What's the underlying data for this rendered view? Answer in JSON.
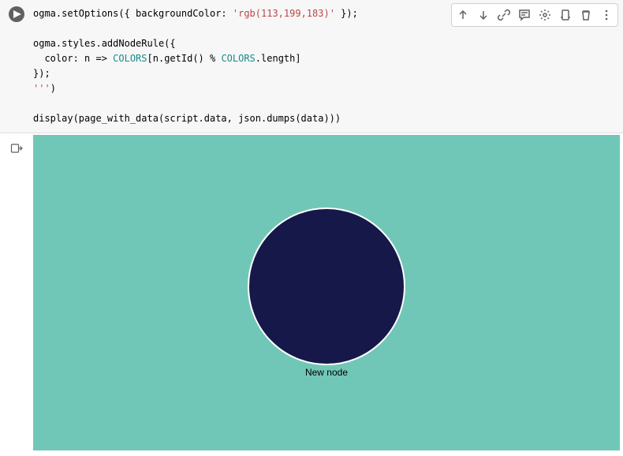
{
  "code": {
    "line1_a": "ogma.setOptions({ backgroundColor: ",
    "line1_str": "'rgb(113,199,183)'",
    "line1_b": " });",
    "line2": "",
    "line3": "ogma.styles.addNodeRule({",
    "line4_a": "  color: n => ",
    "line4_v1": "COLORS",
    "line4_b": "[n.getId() % ",
    "line4_v2": "COLORS",
    "line4_c": ".length]",
    "line5": "});",
    "line6_str": "'''",
    "line6_b": ")",
    "line7": "",
    "line8": "display(page_with_data(script.data, json.dumps(data)))"
  },
  "viz": {
    "bg_color": "#71c7b7",
    "node_color": "#16184a",
    "node_label": "New node"
  },
  "toolbar": {
    "move_up": "Move cell up",
    "move_down": "Move cell down",
    "link": "Get link",
    "comment": "Add comment",
    "settings": "Open settings",
    "mirror": "Mirror cell",
    "delete": "Delete cell",
    "more": "More actions"
  }
}
